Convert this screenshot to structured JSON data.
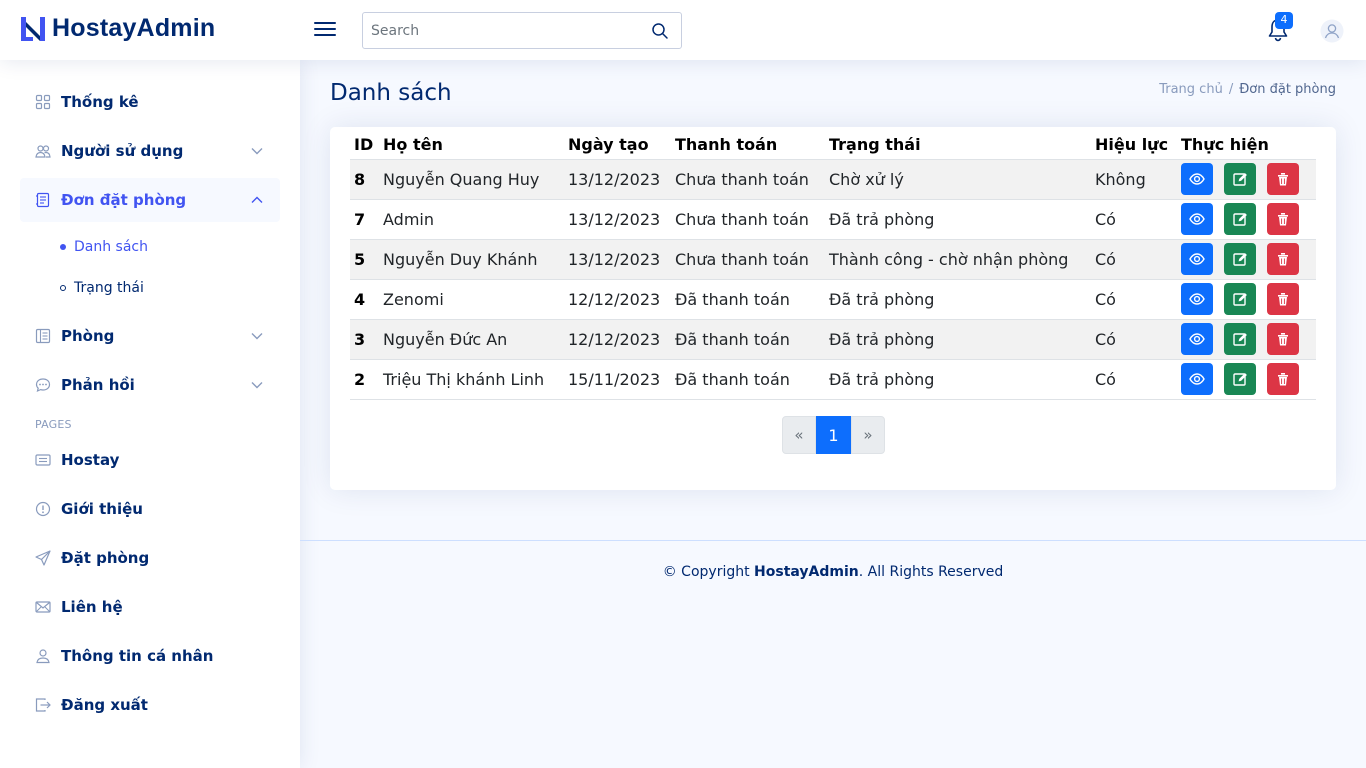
{
  "brand": {
    "name": "HostayAdmin"
  },
  "header": {
    "search_placeholder": "Search",
    "notification_count": "4"
  },
  "sidebar": {
    "items": [
      {
        "label": "Thống kê"
      },
      {
        "label": "Người sử dụng"
      },
      {
        "label": "Đơn đặt phòng"
      },
      {
        "label": "Phòng"
      },
      {
        "label": "Phản hồi"
      }
    ],
    "subitems": [
      {
        "label": "Danh sách"
      },
      {
        "label": "Trạng thái"
      }
    ],
    "pages_heading": "PAGES",
    "pages": [
      {
        "label": "Hostay"
      },
      {
        "label": "Giới thiệu"
      },
      {
        "label": "Đặt phòng"
      },
      {
        "label": "Liên hệ"
      },
      {
        "label": "Thông tin cá nhân"
      },
      {
        "label": "Đăng xuất"
      }
    ]
  },
  "main": {
    "title": "Danh sách",
    "breadcrumb": {
      "home": "Trang chủ",
      "separator": "/",
      "current": "Đơn đặt phòng"
    },
    "table": {
      "headers": [
        "ID",
        "Họ tên",
        "Ngày tạo",
        "Thanh toán",
        "Trạng thái",
        "Hiệu lực",
        "Thực hiện"
      ],
      "rows": [
        {
          "id": "8",
          "name": "Nguyễn Quang Huy",
          "date": "13/12/2023",
          "payment": "Chưa thanh toán",
          "status": "Chờ xử lý",
          "valid": "Không"
        },
        {
          "id": "7",
          "name": "Admin",
          "date": "13/12/2023",
          "payment": "Chưa thanh toán",
          "status": "Đã trả phòng",
          "valid": "Có"
        },
        {
          "id": "5",
          "name": "Nguyễn Duy Khánh",
          "date": "13/12/2023",
          "payment": "Chưa thanh toán",
          "status": "Thành công - chờ nhận phòng",
          "valid": "Có"
        },
        {
          "id": "4",
          "name": "Zenomi",
          "date": "12/12/2023",
          "payment": "Đã thanh toán",
          "status": "Đã trả phòng",
          "valid": "Có"
        },
        {
          "id": "3",
          "name": "Nguyễn Đức An",
          "date": "12/12/2023",
          "payment": "Đã thanh toán",
          "status": "Đã trả phòng",
          "valid": "Có"
        },
        {
          "id": "2",
          "name": "Triệu Thị khánh Linh",
          "date": "15/11/2023",
          "payment": "Đã thanh toán",
          "status": "Đã trả phòng",
          "valid": "Có"
        }
      ]
    },
    "pagination": {
      "prev": "«",
      "current": "1",
      "next": "»"
    }
  },
  "footer": {
    "prefix": "© Copyright ",
    "brand": "HostayAdmin",
    "suffix": ". All Rights Reserved"
  },
  "colors": {
    "primary": "#0d6efd",
    "success": "#198754",
    "danger": "#dc3545",
    "navy": "#012970",
    "accent": "#4154f1"
  },
  "icons": {
    "view": "eye-icon",
    "edit": "edit-icon",
    "delete": "trash-icon",
    "search": "search-icon",
    "notifications": "bell-icon",
    "user": "user-avatar-icon"
  }
}
